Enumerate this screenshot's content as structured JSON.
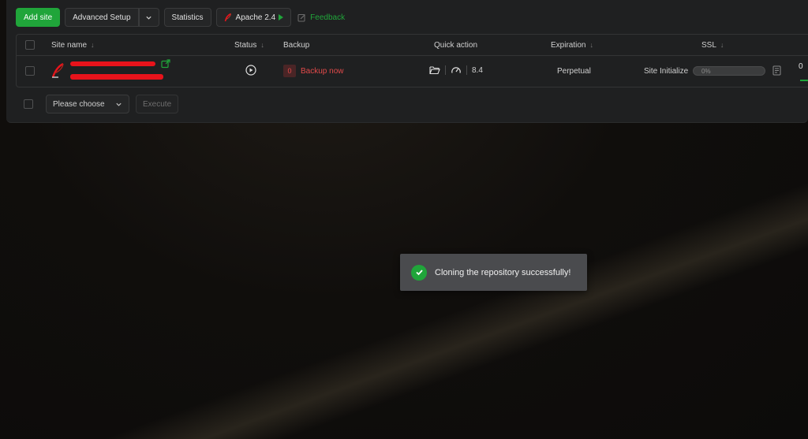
{
  "toolbar": {
    "add_site": "Add site",
    "advanced_setup": "Advanced Setup",
    "statistics": "Statistics",
    "apache": "Apache 2.4",
    "feedback": "Feedback"
  },
  "table": {
    "headers": {
      "site_name": "Site name",
      "status": "Status",
      "backup": "Backup",
      "quick_action": "Quick action",
      "expiration": "Expiration",
      "ssl": "SSL"
    },
    "sort_glyph": "↓",
    "rows": [
      {
        "backup_count": "0",
        "backup_action": "Backup now",
        "php_version": "8.4",
        "expiration": "Perpetual",
        "ssl_status": "Site Initialize",
        "progress_label": "0%",
        "progress_value": 0,
        "extra_count": "0"
      }
    ]
  },
  "bulk": {
    "select_placeholder": "Please choose",
    "execute": "Execute"
  },
  "toast": {
    "message": "Cloning the repository successfully!"
  },
  "colors": {
    "accent": "#20a53a",
    "danger": "#e24a4a",
    "redaction": "#e8131b"
  }
}
